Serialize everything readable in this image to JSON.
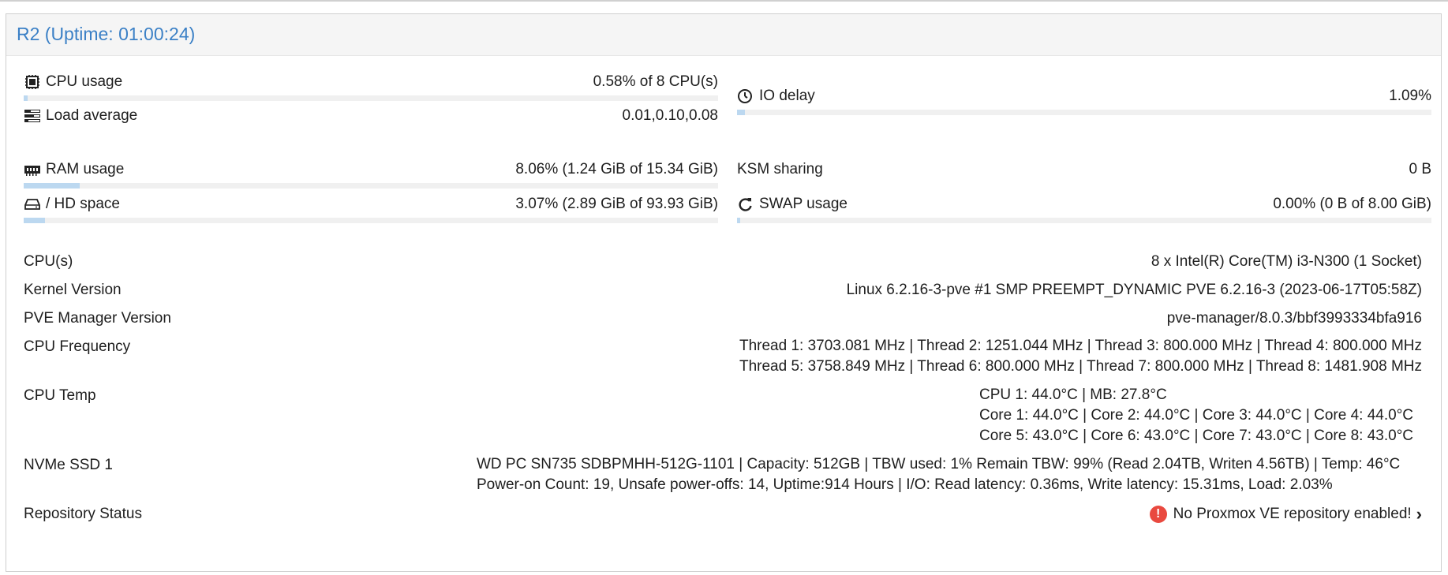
{
  "panel": {
    "title": "R2 (Uptime: 01:00:24)"
  },
  "stats": {
    "cpu": {
      "label": "CPU usage",
      "value": "0.58% of 8 CPU(s)",
      "percent": 0.58,
      "icon": "cpu-icon"
    },
    "load": {
      "label": "Load average",
      "value": "0.01,0.10,0.08",
      "icon": "load-average-icon"
    },
    "io": {
      "label": "IO delay",
      "value": "1.09%",
      "percent": 1.09,
      "icon": "clock-icon"
    },
    "ram": {
      "label": "RAM usage",
      "value": "8.06% (1.24 GiB of 15.34 GiB)",
      "percent": 8.06,
      "icon": "memory-icon"
    },
    "ksm": {
      "label": "KSM sharing",
      "value": "0 B"
    },
    "hd": {
      "label": "/ HD space",
      "value": "3.07% (2.89 GiB of 93.93 GiB)",
      "percent": 3.07,
      "icon": "hard-drive-icon"
    },
    "swap": {
      "label": "SWAP usage",
      "value": "0.00% (0 B of 8.00 GiB)",
      "percent": 0.0,
      "icon": "refresh-icon"
    }
  },
  "info": {
    "cpus": {
      "label": "CPU(s)",
      "value": "8 x Intel(R) Core(TM) i3-N300 (1 Socket)"
    },
    "kernel": {
      "label": "Kernel Version",
      "value": "Linux 6.2.16-3-pve #1 SMP PREEMPT_DYNAMIC PVE 6.2.16-3 (2023-06-17T05:58Z)"
    },
    "pve": {
      "label": "PVE Manager Version",
      "value": "pve-manager/8.0.3/bbf3993334bfa916"
    },
    "freq": {
      "label": "CPU Frequency",
      "lines": [
        "Thread 1: 3703.081 MHz | Thread 2: 1251.044 MHz | Thread 3: 800.000 MHz | Thread 4: 800.000 MHz",
        "Thread 5: 3758.849 MHz | Thread 6: 800.000 MHz | Thread 7: 800.000 MHz | Thread 8: 1481.908 MHz"
      ]
    },
    "temp": {
      "label": "CPU Temp",
      "lines": [
        "CPU 1: 44.0°C | MB: 27.8°C",
        "Core 1: 44.0°C | Core 2: 44.0°C | Core 3: 44.0°C | Core 4: 44.0°C",
        "Core 5: 43.0°C | Core 6: 43.0°C | Core 7: 43.0°C | Core 8: 43.0°C"
      ]
    },
    "nvme": {
      "label": "NVMe SSD 1",
      "lines": [
        "WD PC SN735 SDBPMHH-512G-1101 | Capacity: 512GB | TBW used: 1% Remain TBW: 99% (Read 2.04TB, Writen 4.56TB) | Temp: 46°C",
        "Power-on Count: 19, Unsafe power-offs: 14, Uptime:914 Hours | I/O: Read latency: 0.36ms, Write latency: 15.31ms, Load: 2.03%"
      ]
    },
    "repo": {
      "label": "Repository Status",
      "value": "No Proxmox VE repository enabled!",
      "icon": "error-icon"
    }
  },
  "colors": {
    "accent": "#3b80c6",
    "bar_fill": "#bcd8f0",
    "bar_track": "#f0f0f0",
    "error": "#e9493f"
  }
}
